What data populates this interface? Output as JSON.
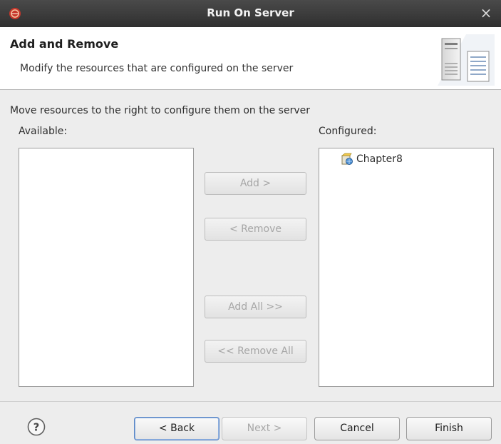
{
  "window": {
    "title": "Run On Server",
    "close_symbol": "×",
    "app_icon": "eclipse-icon"
  },
  "header": {
    "title": "Add and Remove",
    "description": "Modify the resources that are configured on the server",
    "icon": "server-icon"
  },
  "body": {
    "instruction": "Move resources to the right to configure them on the server",
    "available_label": "Available:",
    "configured_label": "Configured:",
    "available_items": [],
    "configured_items": [
      {
        "label": "Chapter8",
        "icon": "web-project-icon"
      }
    ]
  },
  "actions": {
    "add": "Add >",
    "remove": "< Remove",
    "add_all": "Add All >>",
    "remove_all": "<< Remove All"
  },
  "footer": {
    "help_icon": "help-icon",
    "back": "< Back",
    "next": "Next >",
    "cancel": "Cancel",
    "finish": "Finish"
  }
}
